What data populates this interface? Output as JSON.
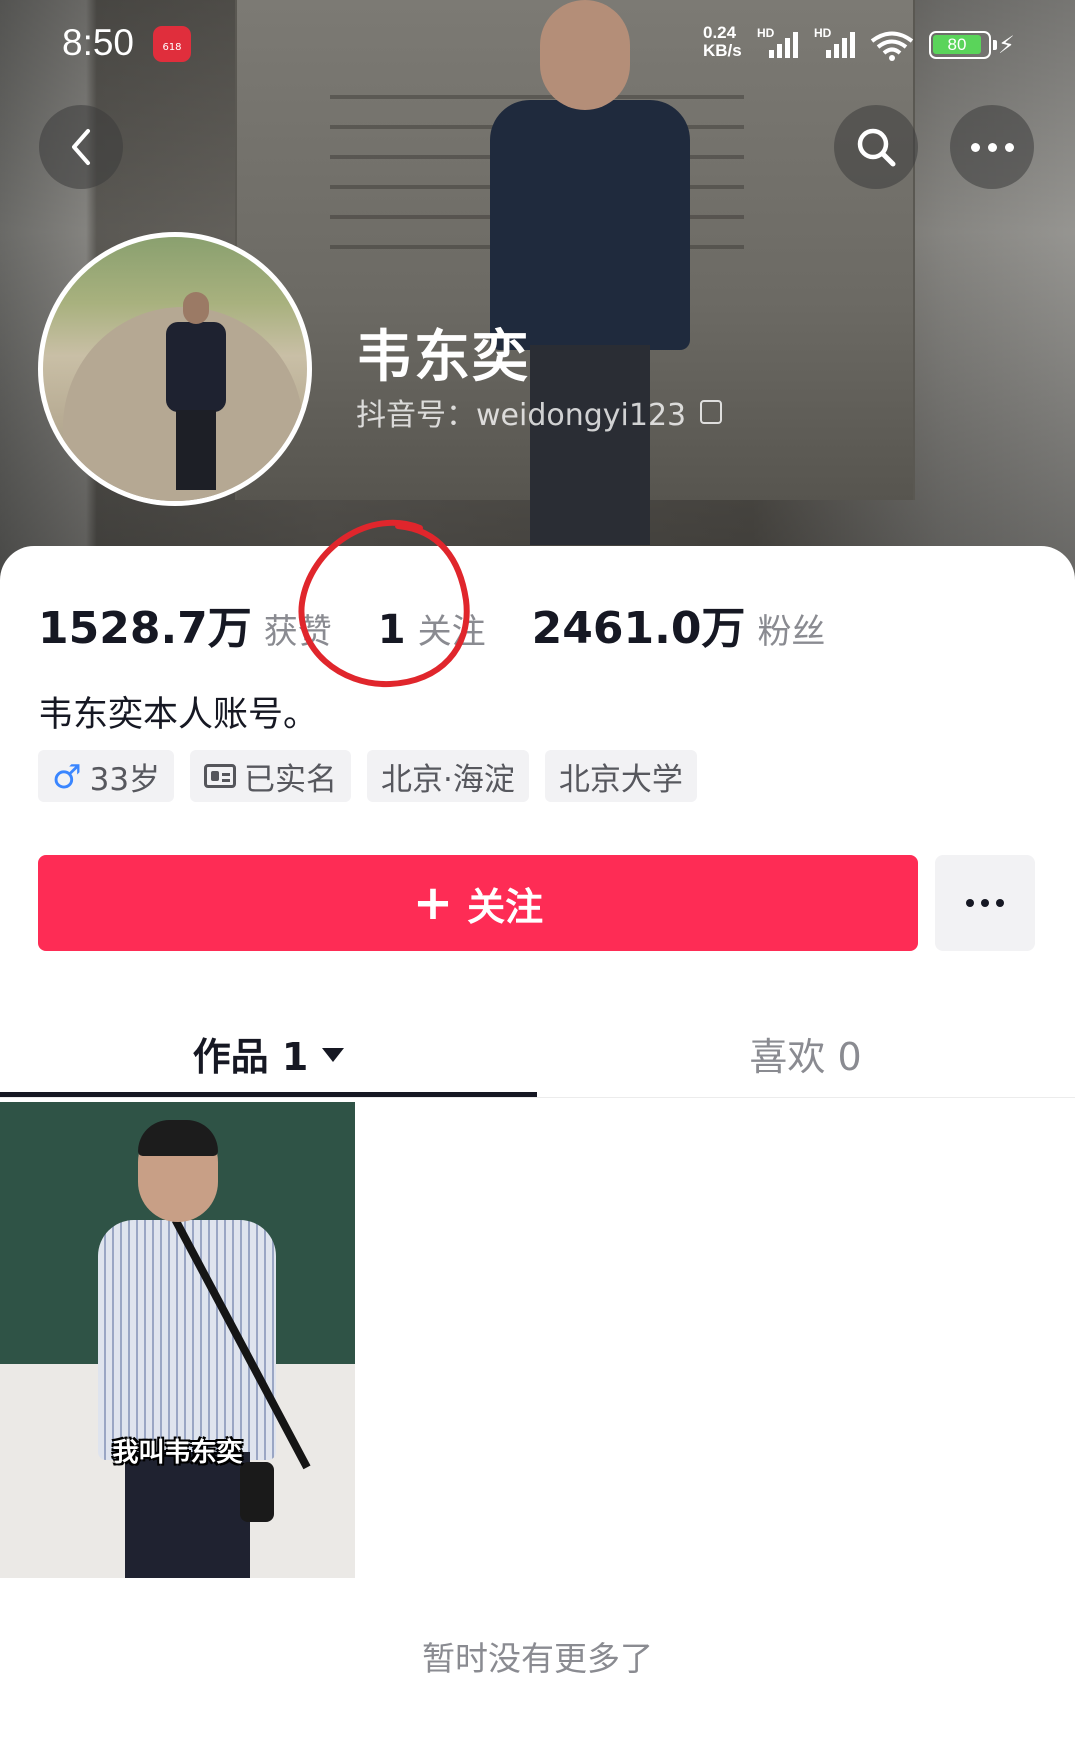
{
  "status_bar": {
    "time": "8:50",
    "app_badge": "618",
    "net_speed_value": "0.24",
    "net_speed_unit": "KB/s",
    "sim1_label": "HD",
    "sim2_label": "HD",
    "battery_level": "80"
  },
  "profile": {
    "name": "韦东奕",
    "douyin_id": "抖音号：weidongyi123",
    "bio": "韦东奕本人账号。"
  },
  "stats": {
    "likes_value": "1528.7万",
    "likes_label": "获赞",
    "following_value": "1",
    "following_label": "关注",
    "followers_value": "2461.0万",
    "followers_label": "粉丝"
  },
  "tags": {
    "age": "33岁",
    "verified": "已实名",
    "location": "北京·海淀",
    "school": "北京大学"
  },
  "actions": {
    "follow_label": "关注"
  },
  "tabs": {
    "works_label": "作品 1",
    "likes_label": "喜欢 0"
  },
  "videos": [
    {
      "caption": "我叫韦东奕"
    }
  ],
  "footer": {
    "no_more": "暂时没有更多了"
  },
  "colors": {
    "accent": "#fe2c55",
    "annotation": "#e0262c",
    "text_primary": "#161823",
    "text_secondary": "#8a8b91",
    "tag_bg": "#f2f2f4"
  }
}
